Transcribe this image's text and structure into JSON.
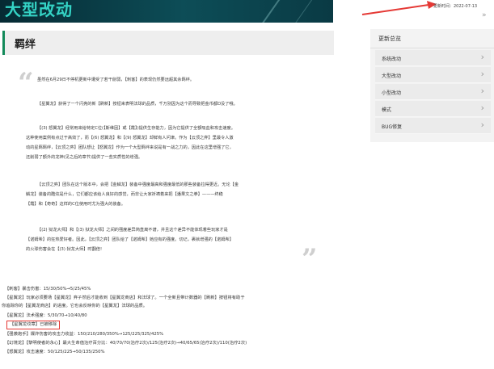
{
  "banner": {
    "title": "大型改动"
  },
  "section": {
    "title": "羁绊"
  },
  "quote": {
    "lines": [
      "虽然在6月29日不停机更新中遭受了若干削弱，【刺客】的表现仍然要远超其余羁绊。",
      "【星翼龙】获得了一个闪亮的新【刷新】按钮来表明法球的品质，千万别因为这个而导致把金币都D没了哦。",
      "【(3) 怒翼龙】经常用来给特定C位(【斯维因】或【霞】)提供生存能力，因为它提供了全额吸血和攻击速度。",
      "这种使用案例有点过于高效了，而【(6) 怒翼龙】和【(9) 怒翼龙】却鲜有人问津。作为【云顶之弈】里最令人激",
      "动的星羁羁绊，【云顶之弈】团队想让【怒翼龙】作为一个大型羁绊来说是有一战之力的，因此在这里增强了它，",
      "还削弱了额外的龙神(见之后的章节)提供了一些实质性的增强。",
      "【云顶之弈】团队在这个版本中，会把【金鳞龙】装备中强度最高和强度最低的那些装备拉得更近。无论【金",
      "鳞龙】装备的酷炫是什么，它们都应该给人良好的感觉，而非让大家祈祷着来把【潘果文之拳】———终稳",
      "【霞】和【奇奇】这样的C位使用时尤为强大的装备。",
      "【(2) 狱龙大师】和【(3) 狱龙大师】之间的强度差异简直离不谱，并且这个差异不能体现着些玩家才是",
      "【诺姆希】的狂热爱好者。因此，【云顶之弈】团队给了【诺姆希】她应有的强度。切记，裹就增强的【诺姆希】",
      "的火球伤害会在【(3) 狱龙大师】时翻倍!"
    ]
  },
  "stats": {
    "lines": [
      "【刺客】暴击伤害：15/30/50%→5/25/45%",
      "【星翼龙】玩家必须要场【星翼龙】弃子然后才能收到【星翼龙商店】和法球了。一个全新且带计数器的【刷新】按钮将有助于",
      "你追踪你的【星翼龙商店】的进度。它也会反映你的【星翼龙】法球的品质。",
      "【星翼龙】法术强度：5/30/70→10/40/80",
      "【星翼龙纹章】已被移除",
      "【强袭炮手】爆炸伤害的攻击力收益：150/210/280/350%→125/225/325/425%",
      "【幻境龙】【黎明使者的永心】最大生命值治疗百分比：40/70/70(治疗2次)/125(治疗2次)→40/65/65(治疗2次)/110(治疗2次)",
      "【怒翼龙】攻击速度：50/125/225→50/135/250%"
    ]
  },
  "sidebar": {
    "update_time": "更新时间：2022-07-13",
    "collapse_icon": "double-chevron-right-icon",
    "header": "更新总览",
    "items": [
      {
        "label": "系统改动"
      },
      {
        "label": "大型改动"
      },
      {
        "label": "小型改动"
      },
      {
        "label": "模式"
      },
      {
        "label": "BUG修复"
      }
    ]
  },
  "colors": {
    "accent": "#138a5a",
    "banner_text": "#34d3c5",
    "banner_bg": "#0d4d57",
    "highlight_border": "#e53935",
    "arrow": "#e53935"
  }
}
